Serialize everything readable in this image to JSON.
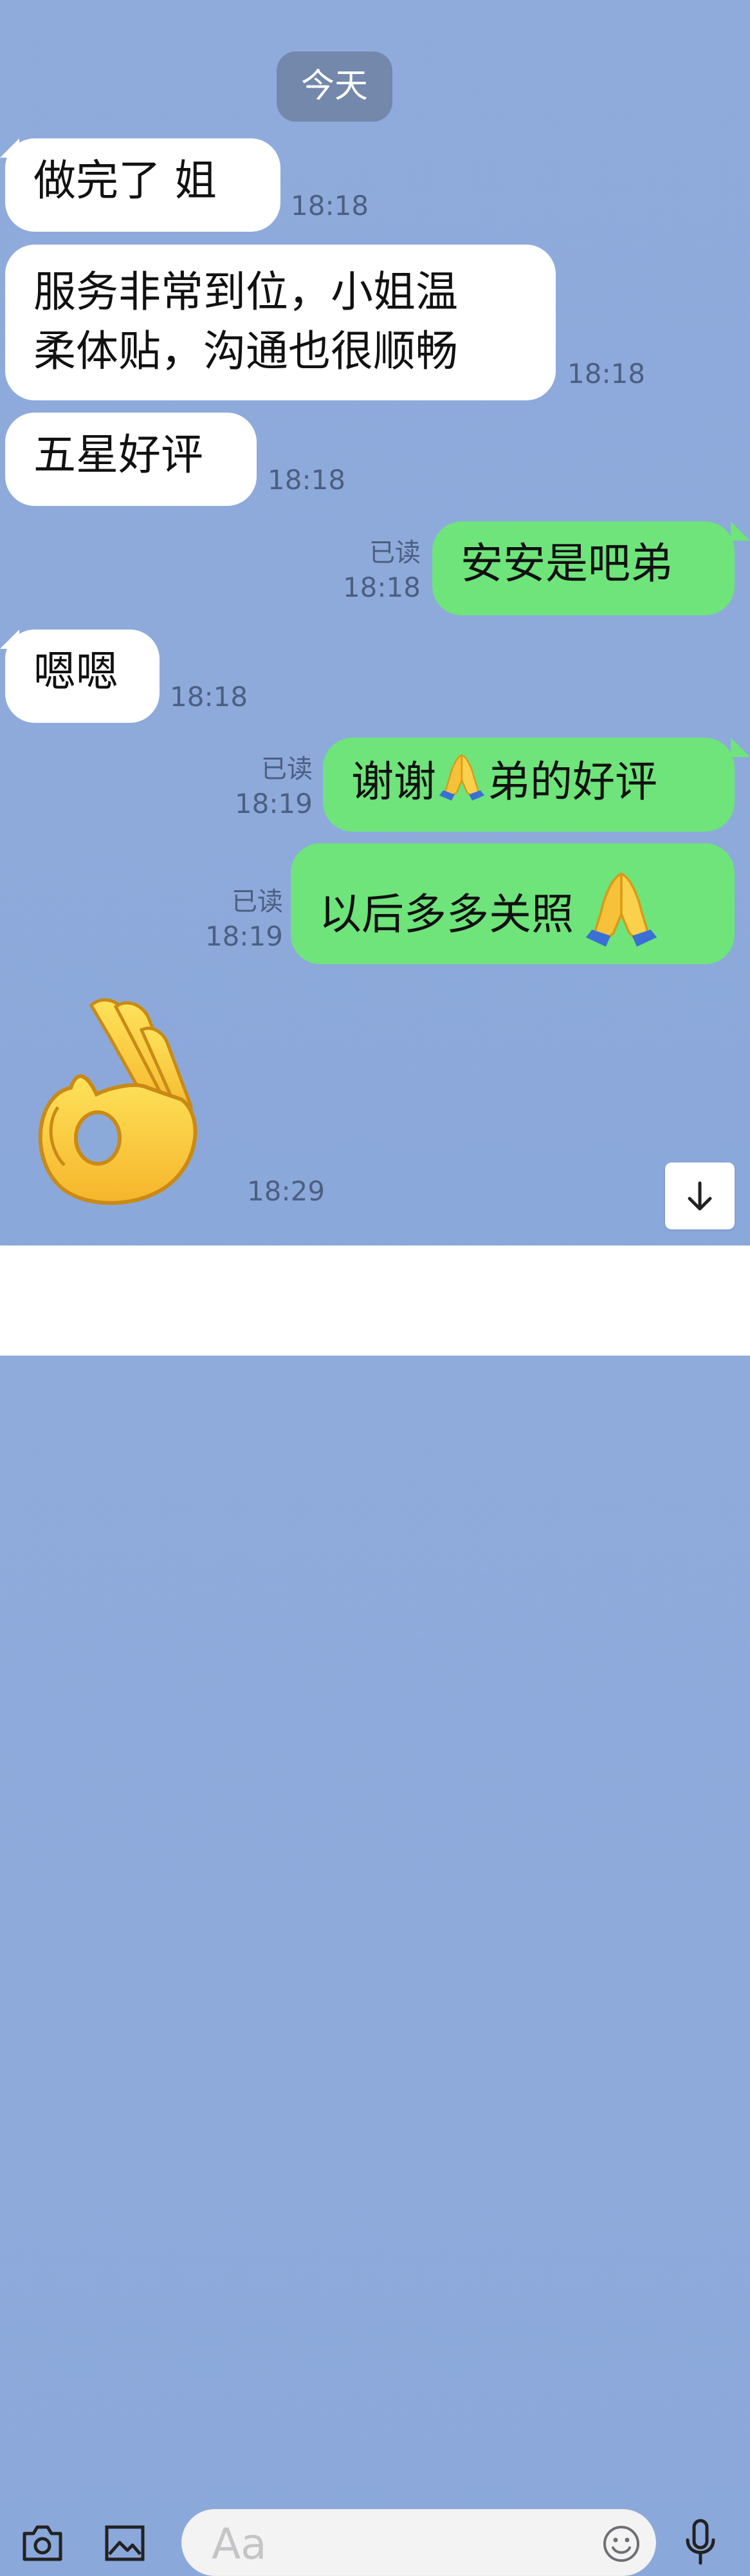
{
  "date_label": "今天",
  "messages": [
    {
      "text": "做完了  姐",
      "time": "18:18"
    },
    {
      "line1": "服务非常到位，小姐温",
      "line2": "柔体贴，沟通也很顺畅",
      "time": "18:18"
    },
    {
      "text": "五星好评",
      "time": "18:18"
    },
    {
      "text": "安安是吧弟",
      "read": "已读",
      "time": "18:18"
    },
    {
      "text": "嗯嗯",
      "time": "18:18"
    },
    {
      "text_a": "谢谢",
      "text_b": "弟的好评",
      "read": "已读",
      "time": "18:19"
    },
    {
      "text": "以后多多关照",
      "read": "已读",
      "time": "18:19"
    },
    {
      "sticker": "ok-hand-emoji",
      "time": "18:29"
    }
  ],
  "input": {
    "placeholder": "Aa"
  },
  "colors": {
    "incoming": "#ffffff",
    "outgoing": "#6ee47a",
    "background": "#8fabdc"
  }
}
